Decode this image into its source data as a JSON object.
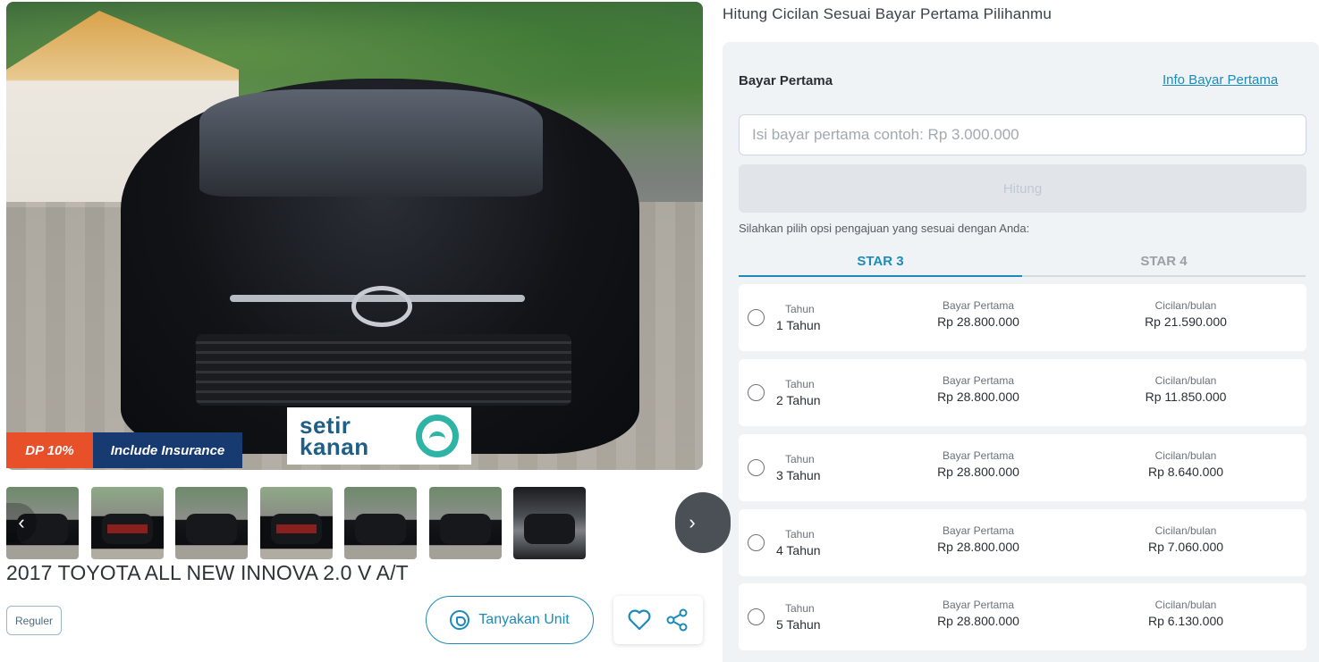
{
  "hero": {
    "badges": {
      "dp": "DP 10%",
      "insurance": "Include Insurance"
    },
    "watermark": {
      "line1": "setir",
      "line2": "kanan"
    }
  },
  "thumbnails_count": 7,
  "listing": {
    "title": "2017 TOYOTA ALL NEW INNOVA 2.0 V A/T",
    "tag": "Reguler",
    "ask_button": "Tanyakan Unit"
  },
  "calculator": {
    "heading": "Hitung Cicilan Sesuai Bayar Pertama Pilihanmu",
    "dp_label": "Bayar Pertama",
    "dp_info_link": "Info Bayar Pertama",
    "dp_input": {
      "value": "",
      "placeholder": "Isi bayar pertama contoh: Rp 3.000.000"
    },
    "calc_button": "Hitung",
    "hint": "Silahkan pilih opsi pengajuan yang sesuai dengan Anda:",
    "tabs": [
      {
        "label": "STAR 3",
        "active": true
      },
      {
        "label": "STAR 4",
        "active": false
      }
    ],
    "column_labels": {
      "tenor": "Tahun",
      "dp": "Bayar Pertama",
      "installment": "Cicilan/bulan"
    },
    "options": [
      {
        "tenor": "1 Tahun",
        "dp": "Rp 28.800.000",
        "installment": "Rp 21.590.000"
      },
      {
        "tenor": "2 Tahun",
        "dp": "Rp 28.800.000",
        "installment": "Rp 11.850.000"
      },
      {
        "tenor": "3 Tahun",
        "dp": "Rp 28.800.000",
        "installment": "Rp 8.640.000"
      },
      {
        "tenor": "4 Tahun",
        "dp": "Rp 28.800.000",
        "installment": "Rp 7.060.000"
      },
      {
        "tenor": "5 Tahun",
        "dp": "Rp 28.800.000",
        "installment": "Rp 6.130.000"
      }
    ]
  },
  "colors": {
    "accent": "#1d8bb8",
    "dp_badge": "#e8502a",
    "insurance_badge": "#173a70",
    "panel_bg": "#f0f3f6"
  },
  "icons": {
    "prev": "chevron-left-icon",
    "next": "chevron-right-icon",
    "whatsapp": "whatsapp-icon",
    "favorite": "heart-icon",
    "share": "share-icon"
  }
}
